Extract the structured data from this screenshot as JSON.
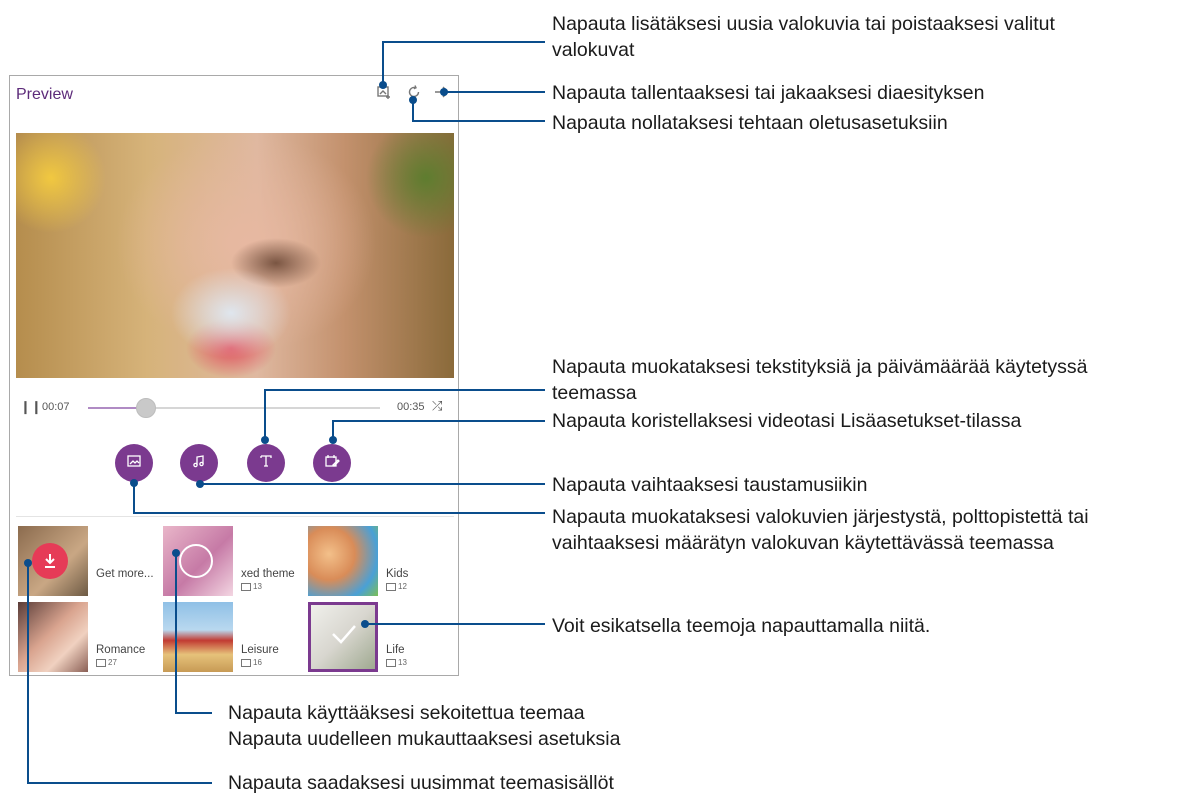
{
  "app": {
    "title": "Preview",
    "top_icons": [
      {
        "name": "add-photos-icon"
      },
      {
        "name": "reset-icon"
      },
      {
        "name": "next-arrow-icon"
      }
    ]
  },
  "player": {
    "current_time": "00:07",
    "total_time": "00:35",
    "progress": 0.2,
    "pause_icon": "pause-icon",
    "shuffle_icon": "shuffle-icon"
  },
  "action_buttons": [
    {
      "name": "photo-edit-button",
      "icon": "image-icon"
    },
    {
      "name": "music-button",
      "icon": "music-note-icon"
    },
    {
      "name": "text-button",
      "icon": "text-icon"
    },
    {
      "name": "decorate-button",
      "icon": "decorate-icon"
    }
  ],
  "themes": [
    {
      "label": "Get more...",
      "count": ""
    },
    {
      "label": "xed theme",
      "count": "13"
    },
    {
      "label": "Kids",
      "count": "12"
    },
    {
      "label": "Romance",
      "count": "27"
    },
    {
      "label": "Leisure",
      "count": "16"
    },
    {
      "label": "Life",
      "count": "13",
      "selected": true
    }
  ],
  "callouts": {
    "add_photos": "Napauta lisätäksesi uusia valokuvia tai poistaaksesi valitut\nvalokuvat",
    "save_share": "Napauta tallentaaksesi tai jakaaksesi diaesityksen",
    "reset": "Napauta nollataksesi tehtaan oletusasetuksiin",
    "edit_text": "Napauta muokataksesi tekstityksiä ja päivämäärää käytetyssä\nteemassa",
    "decorate": "Napauta koristellaksesi videotasi Lisäasetukset-tilassa",
    "music": "Napauta vaihtaaksesi taustamusiikin",
    "edit_photos": "Napauta muokataksesi valokuvien järjestystä, polttopistettä tai\nvaihtaaksesi määrätyn valokuvan käytettävässä teemassa",
    "preview_themes": "Voit esikatsella teemoja napauttamalla niitä.",
    "mixed_theme": "Napauta käyttääksesi sekoitettua teemaa\nNapauta uudelleen mukauttaaksesi asetuksia",
    "get_more": "Napauta saadaksesi uusimmat teemasisällöt"
  },
  "colors": {
    "accent": "#7b3a8f",
    "download": "#e63b57",
    "callout_line": "#0a4d8c"
  }
}
